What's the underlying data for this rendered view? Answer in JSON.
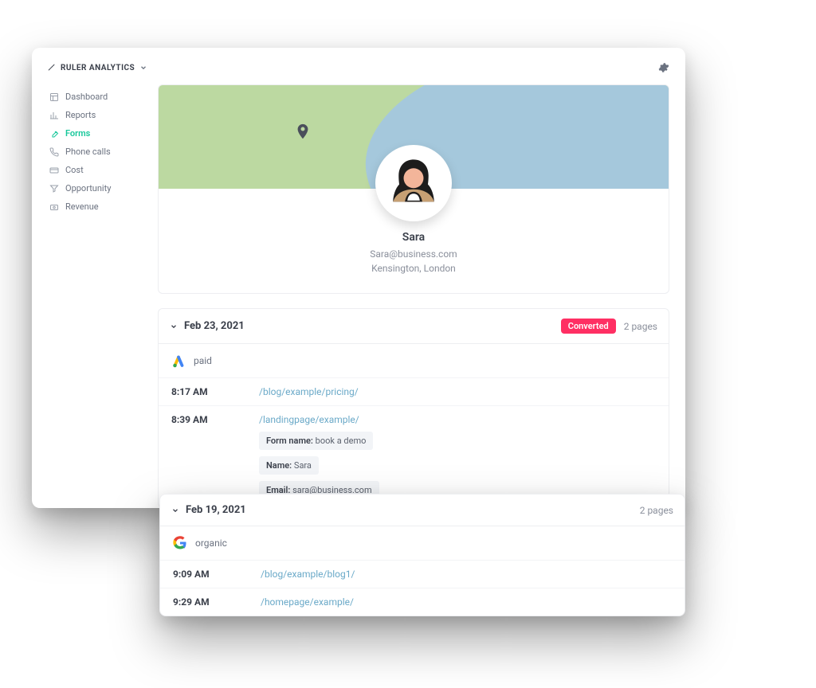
{
  "brand": {
    "name": "RULER ANALYTICS"
  },
  "sidebar": {
    "items": [
      {
        "label": "Dashboard"
      },
      {
        "label": "Reports"
      },
      {
        "label": "Forms"
      },
      {
        "label": "Phone calls"
      },
      {
        "label": "Cost"
      },
      {
        "label": "Opportunity"
      },
      {
        "label": "Revenue"
      }
    ]
  },
  "profile": {
    "name": "Sara",
    "email": "Sara@business.com",
    "location": "Kensington, London"
  },
  "sessions": [
    {
      "date": "Feb 23, 2021",
      "converted_label": "Converted",
      "pages_label": "2 pages",
      "source_channel": "paid",
      "source_icon": "google-ads",
      "events": [
        {
          "time": "8:17 AM",
          "path": "/blog/example/pricing/"
        },
        {
          "time": "8:39 AM",
          "path": "/landingpage/example/",
          "form": {
            "form_name_key": "Form name:",
            "form_name_val": "book a demo",
            "name_key": "Name:",
            "name_val": "Sara",
            "email_key": "Email:",
            "email_val": "sara@business.com"
          }
        }
      ]
    },
    {
      "date": "Feb 19, 2021",
      "pages_label": "2 pages",
      "source_channel": "organic",
      "source_icon": "google",
      "events": [
        {
          "time": "9:09 AM",
          "path": "/blog/example/blog1/"
        },
        {
          "time": "9:29 AM",
          "path": "/homepage/example/"
        }
      ]
    }
  ]
}
